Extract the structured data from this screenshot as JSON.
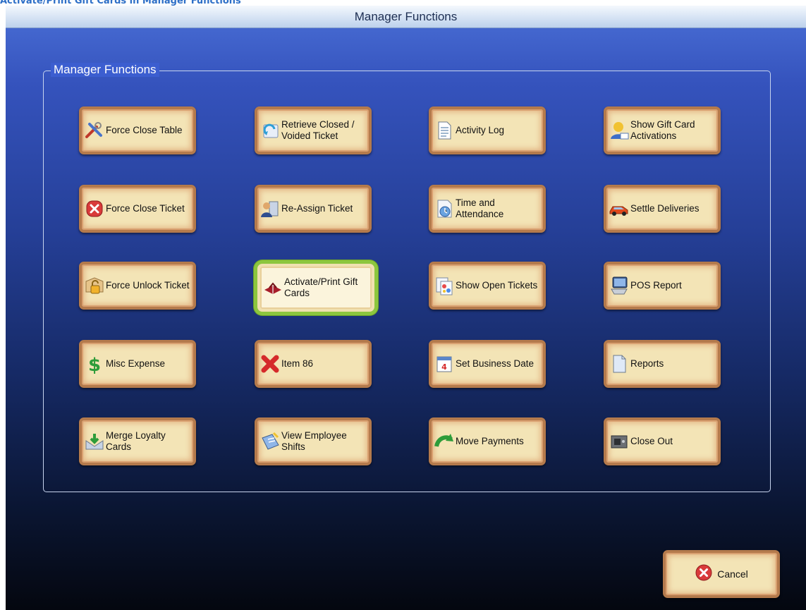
{
  "caption": "Activate/Print Gift Cards in Manager Functions",
  "window": {
    "title": "Manager Functions"
  },
  "group": {
    "label": "Manager Functions"
  },
  "buttons": [
    {
      "label": "Force Close Table",
      "icon": "tools-icon"
    },
    {
      "label": "Retrieve Closed / Voided Ticket",
      "icon": "retrieve-icon"
    },
    {
      "label": "Activity Log",
      "icon": "document-icon"
    },
    {
      "label": "Show Gift Card Activations",
      "icon": "user-card-icon"
    },
    {
      "label": "Force Close Ticket",
      "icon": "close-circle-icon"
    },
    {
      "label": "Re-Assign Ticket",
      "icon": "user-assign-icon"
    },
    {
      "label": "Time and Attendance",
      "icon": "clock-icon"
    },
    {
      "label": "Settle Deliveries",
      "icon": "car-icon"
    },
    {
      "label": "Force Unlock Ticket",
      "icon": "lock-icon"
    },
    {
      "label": "Activate/Print Gift Cards",
      "icon": "gift-icon",
      "selected": true
    },
    {
      "label": "Show Open Tickets",
      "icon": "tickets-icon"
    },
    {
      "label": "POS Report",
      "icon": "monitor-icon"
    },
    {
      "label": "Misc Expense",
      "icon": "dollar-icon"
    },
    {
      "label": "Item 86",
      "icon": "red-x-icon"
    },
    {
      "label": "Set Business Date",
      "icon": "calendar-icon"
    },
    {
      "label": "Reports",
      "icon": "report-icon"
    },
    {
      "label": "Merge Loyalty Cards",
      "icon": "merge-icon"
    },
    {
      "label": "View Employee Shifts",
      "icon": "shifts-icon"
    },
    {
      "label": "Move Payments",
      "icon": "arrow-icon"
    },
    {
      "label": "Close Out",
      "icon": "safe-icon"
    }
  ],
  "cancel": {
    "label": "Cancel",
    "icon": "cancel-icon"
  },
  "colors": {
    "highlight": "#8cc63e",
    "button_face": "#f3e4b6",
    "button_border": "#b47a4c"
  }
}
